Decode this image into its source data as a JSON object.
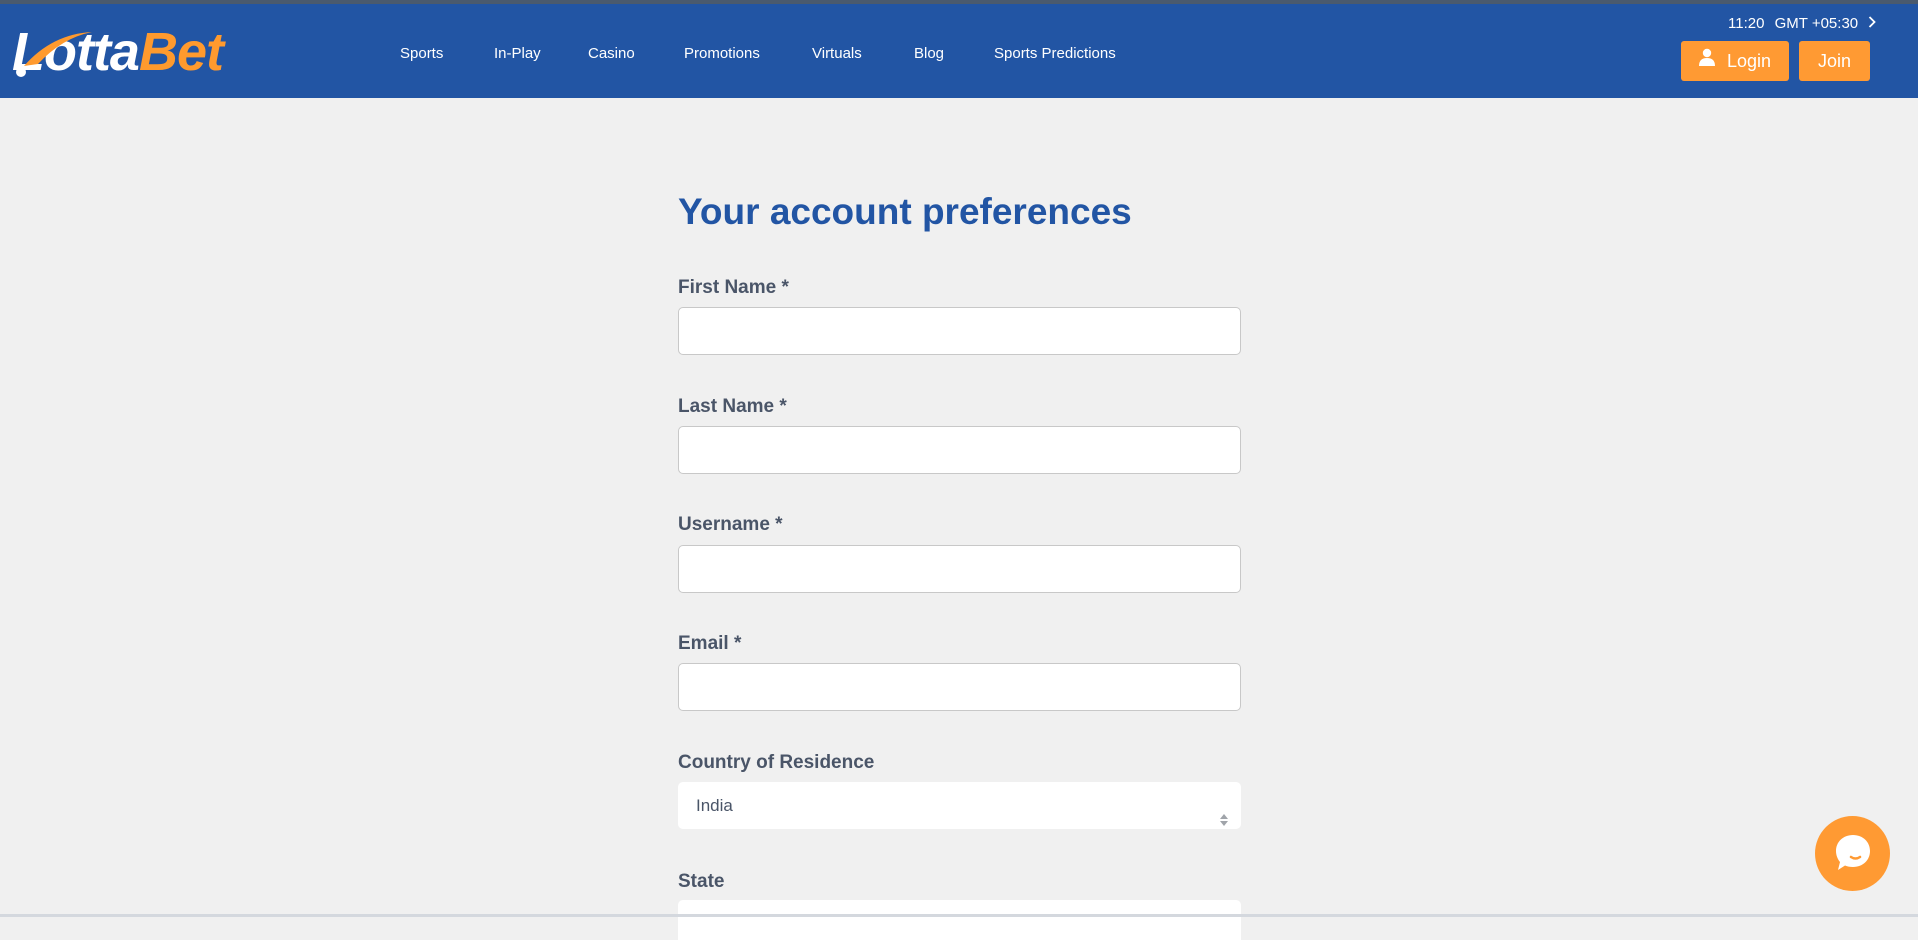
{
  "brand": {
    "name_part1": "Lotta",
    "name_part2": "Bet",
    "primary_color": "#2255a4",
    "accent_color": "#ff9a33"
  },
  "header": {
    "nav": [
      {
        "label": "Sports"
      },
      {
        "label": "In-Play"
      },
      {
        "label": "Casino"
      },
      {
        "label": "Promotions"
      },
      {
        "label": "Virtuals"
      },
      {
        "label": "Blog"
      },
      {
        "label": "Sports Predictions"
      }
    ],
    "clock": {
      "time": "11:20",
      "timezone": "GMT +05:30",
      "icon": "chevron-right-icon"
    },
    "login_label": "Login",
    "login_icon": "user-icon",
    "join_label": "Join"
  },
  "form": {
    "title": "Your account preferences",
    "fields": [
      {
        "label": "First Name *",
        "value": "",
        "placeholder": ""
      },
      {
        "label": "Last Name *",
        "value": "",
        "placeholder": ""
      },
      {
        "label": "Username *",
        "value": "",
        "placeholder": ""
      },
      {
        "label": "Email *",
        "value": "",
        "placeholder": ""
      }
    ],
    "country": {
      "label": "Country of Residence",
      "selected": "India",
      "icon": "sort-arrows-icon"
    },
    "state": {
      "label": "State",
      "value": ""
    }
  },
  "chat": {
    "icon": "chat-bubble-icon"
  }
}
